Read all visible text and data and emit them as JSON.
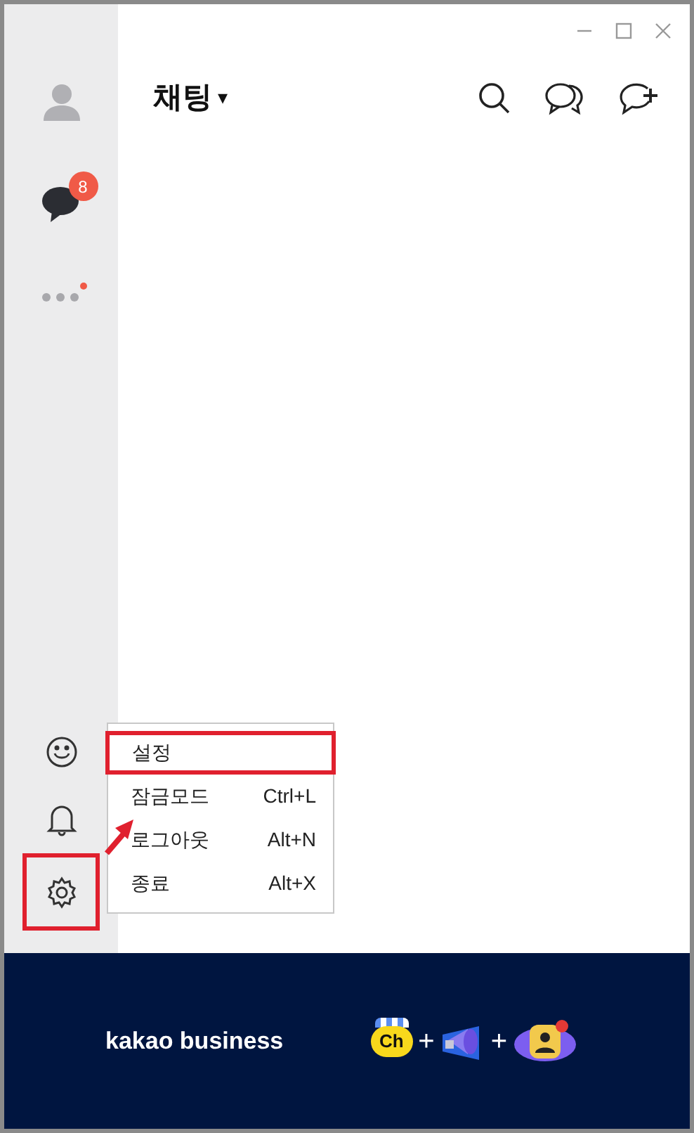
{
  "sidebar": {
    "chat_badge": "8",
    "more_dot": true
  },
  "header": {
    "title": "채팅",
    "dropdown_caret": "▾"
  },
  "menu": {
    "items": [
      {
        "label": "설정",
        "highlighted": true
      },
      {
        "label": "잠금모드",
        "shortcut": "Ctrl+L",
        "highlighted": false
      },
      {
        "label": "로그아웃",
        "shortcut": "Alt+N",
        "highlighted": false
      },
      {
        "label": "종료",
        "shortcut": "Alt+X",
        "highlighted": false
      }
    ]
  },
  "annotation": {
    "settings_icon_highlighted": true
  },
  "banner": {
    "brand": "kakao business",
    "channel_label": "Ch",
    "plus_signs": [
      "+",
      "+"
    ]
  }
}
